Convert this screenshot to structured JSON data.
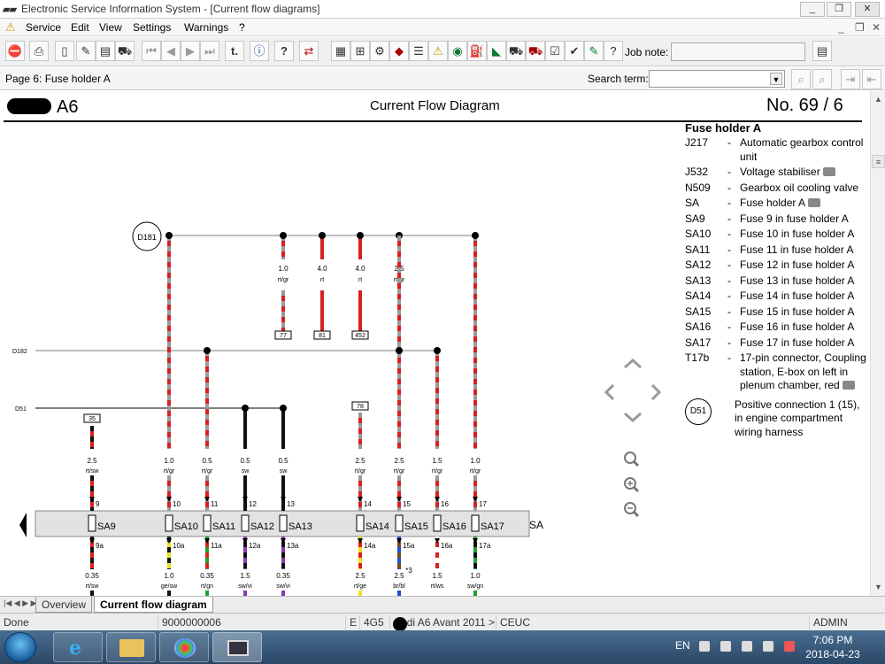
{
  "window": {
    "title": "Electronic Service Information System - [Current flow diagrams]",
    "buttons": {
      "minimize": "_",
      "restore": "❐",
      "close": "✕"
    },
    "inner_buttons": {
      "minimize": "_",
      "restore": "❐",
      "close": "✕"
    }
  },
  "menu": [
    "Service",
    "Edit",
    "View",
    "Settings",
    "Warnings",
    "?"
  ],
  "toolbar": {
    "job_note_label": "Job note:",
    "job_note_value": ""
  },
  "address": {
    "page_label": "Page 6: Fuse holder A",
    "search_label": "Search term:",
    "search_value": ""
  },
  "diagram": {
    "model": "A6",
    "title": "Current Flow Diagram",
    "page_no": "No.  69 / 6",
    "labels": {
      "d181": "D181",
      "d182": "D182",
      "d51": "D51",
      "term_35": "35",
      "term_77": "77",
      "term_81": "81",
      "term_452": "452",
      "term_78": "78",
      "sa": "SA",
      "plus3": "*3"
    },
    "top_wires": [
      {
        "size": "1.0",
        "color": "rt/gr"
      },
      {
        "size": "4.0",
        "color": "rt"
      },
      {
        "size": "4.0",
        "color": "rt"
      },
      {
        "size": "2.5",
        "color": "rt/gr"
      }
    ],
    "fuse_slots": [
      {
        "fuse": "SA9",
        "in_pin": "9",
        "out_pin": "9a",
        "in_size": "2.5",
        "in_color": "rt/sw",
        "out_size": "0.35",
        "out_color": "rt/sw"
      },
      {
        "fuse": "SA10",
        "in_pin": "10",
        "out_pin": "10a",
        "in_size": "1.0",
        "in_color": "rt/gr",
        "out_size": "1.0",
        "out_color": "ge/sw"
      },
      {
        "fuse": "SA11",
        "in_pin": "11",
        "out_pin": "11a",
        "in_size": "0.5",
        "in_color": "rt/gr",
        "out_size": "0.35",
        "out_color": "rt/gn"
      },
      {
        "fuse": "SA12",
        "in_pin": "12",
        "out_pin": "12a",
        "in_size": "0.5",
        "in_color": "sw",
        "out_size": "1.5",
        "out_color": "sw/vi"
      },
      {
        "fuse": "SA13",
        "in_pin": "13",
        "out_pin": "13a",
        "in_size": "0.5",
        "in_color": "sw",
        "out_size": "0.35",
        "out_color": "sw/vi"
      },
      {
        "fuse": "SA14",
        "in_pin": "14",
        "out_pin": "14a",
        "in_size": "2.5",
        "in_color": "rt/gr",
        "out_size": "2.5",
        "out_color": "rt/ge"
      },
      {
        "fuse": "SA15",
        "in_pin": "15",
        "out_pin": "15a",
        "in_size": "2.5",
        "in_color": "rt/gr",
        "out_size": "2.5",
        "out_color": "br/bl"
      },
      {
        "fuse": "SA16",
        "in_pin": "16",
        "out_pin": "16a",
        "in_size": "1.5",
        "in_color": "rt/gr",
        "out_size": "1.5",
        "out_color": "rt/ws"
      },
      {
        "fuse": "SA17",
        "in_pin": "17",
        "out_pin": "17a",
        "in_size": "1.0",
        "in_color": "rt/gr",
        "out_size": "1.0",
        "out_color": "sw/gn"
      }
    ]
  },
  "legend": {
    "title": "Fuse holder A",
    "items": [
      {
        "code": "J217",
        "desc": "Automatic gearbox control unit",
        "camera": false
      },
      {
        "code": "J532",
        "desc": "Voltage stabiliser",
        "camera": true
      },
      {
        "code": "N509",
        "desc": "Gearbox oil cooling valve",
        "camera": false
      },
      {
        "code": "SA",
        "desc": "Fuse holder A",
        "camera": true
      },
      {
        "code": "SA9",
        "desc": "Fuse 9 in fuse holder A",
        "camera": false
      },
      {
        "code": "SA10",
        "desc": "Fuse 10 in fuse holder A",
        "camera": false
      },
      {
        "code": "SA11",
        "desc": "Fuse 11 in fuse holder A",
        "camera": false
      },
      {
        "code": "SA12",
        "desc": "Fuse 12 in fuse holder A",
        "camera": false
      },
      {
        "code": "SA13",
        "desc": "Fuse 13 in fuse holder A",
        "camera": false
      },
      {
        "code": "SA14",
        "desc": "Fuse 14 in fuse holder A",
        "camera": false
      },
      {
        "code": "SA15",
        "desc": "Fuse 15 in fuse holder A",
        "camera": false
      },
      {
        "code": "SA16",
        "desc": "Fuse 16 in fuse holder A",
        "camera": false
      },
      {
        "code": "SA17",
        "desc": "Fuse 17 in fuse holder A",
        "camera": false
      },
      {
        "code": "T17b",
        "desc": "17-pin connector, Coupling station, E-box on left in plenum chamber, red",
        "camera": true
      }
    ],
    "d51": {
      "code": "D51",
      "desc": "Positive connection 1 (15), in engine compartment wiring harness"
    }
  },
  "tabs": {
    "overview": "Overview",
    "current": "Current flow diagram",
    "nav": "|◀ ◀ ▶ ▶|"
  },
  "status": {
    "done": "Done",
    "id": "9000000006",
    "e": "E",
    "code": "4G5",
    "model": "Audi A6 Avant 2011 >",
    "region": "CEUC",
    "user": "ADMIN"
  },
  "taskbar": {
    "lang": "EN",
    "time": "7:06 PM",
    "date": "2018-04-23"
  }
}
